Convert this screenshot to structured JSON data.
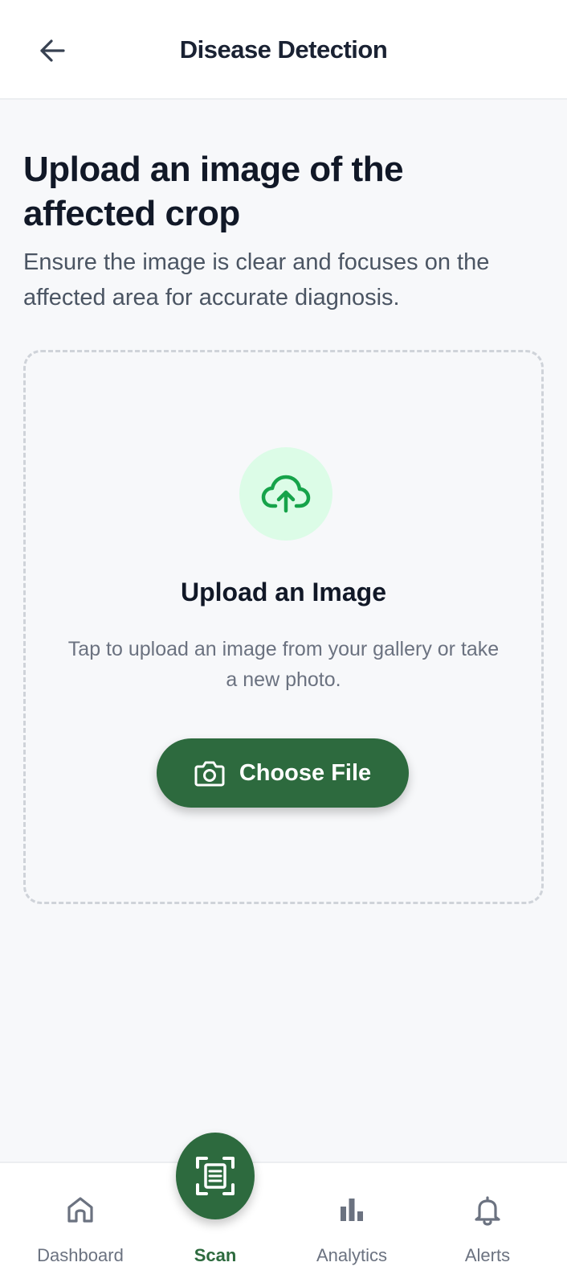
{
  "header": {
    "title": "Disease Detection",
    "back_icon": "arrow-left-icon"
  },
  "intro": {
    "heading": "Upload an image of the affected crop",
    "subtitle": "Ensure the image is clear and focuses on the affected area for accurate diagnosis."
  },
  "upload": {
    "icon": "cloud-upload-icon",
    "title": "Upload an Image",
    "description": "Tap to upload an image from your gallery or take a new photo.",
    "button_icon": "camera-icon",
    "button_label": "Choose File"
  },
  "bottom_nav": {
    "items": [
      {
        "label": "Dashboard",
        "icon": "home-icon",
        "active": false
      },
      {
        "label": "Scan",
        "icon": "scan-document-icon",
        "active": true
      },
      {
        "label": "Analytics",
        "icon": "bar-chart-icon",
        "active": false
      },
      {
        "label": "Alerts",
        "icon": "bell-icon",
        "active": false
      }
    ]
  },
  "colors": {
    "primary": "#2d6a3e",
    "upload_icon_bg": "#dcfce7",
    "upload_icon_fg": "#16a34a",
    "background": "#f7f8fa"
  }
}
